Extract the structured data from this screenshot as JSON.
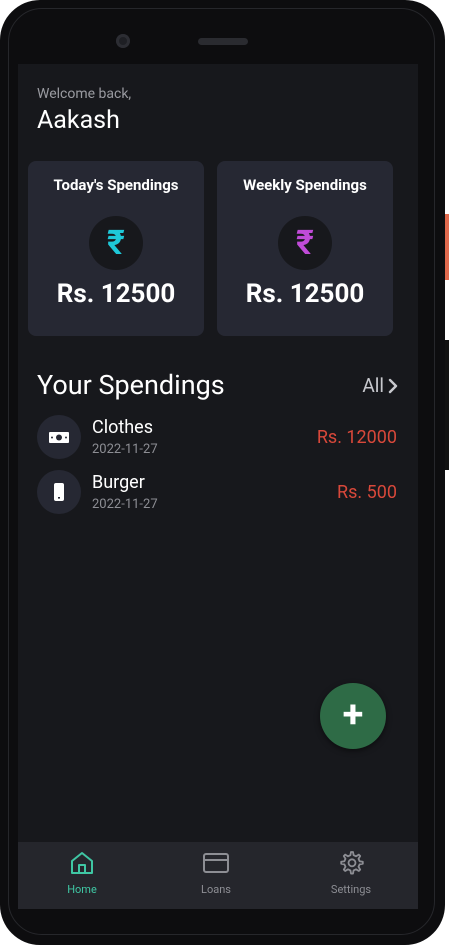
{
  "greeting": {
    "welcome": "Welcome back,",
    "name": "Aakash"
  },
  "cards": [
    {
      "title": "Today's Spendings",
      "icon": "rupee-icon",
      "icon_color": "#1ec8d8",
      "amount": "Rs. 12500"
    },
    {
      "title": "Weekly Spendings",
      "icon": "rupee-icon",
      "icon_color": "#c04bd8",
      "amount": "Rs. 12500"
    }
  ],
  "spendings": {
    "title": "Your Spendings",
    "all_label": "All",
    "items": [
      {
        "name": "Clothes",
        "date": "2022-11-27",
        "amount": "Rs. 12000",
        "icon": "cash-icon"
      },
      {
        "name": "Burger",
        "date": "2022-11-27",
        "amount": "Rs. 500",
        "icon": "phone-icon"
      }
    ]
  },
  "fab": {
    "label": "+"
  },
  "nav": {
    "items": [
      {
        "label": "Home",
        "icon": "home-icon",
        "active": true
      },
      {
        "label": "Loans",
        "icon": "card-icon",
        "active": false
      },
      {
        "label": "Settings",
        "icon": "gear-icon",
        "active": false
      }
    ]
  },
  "colors": {
    "accent": "#3fc6a3",
    "expense": "#d8483a",
    "fab": "#2e6b46",
    "background": "#17181c",
    "card": "#262833"
  }
}
